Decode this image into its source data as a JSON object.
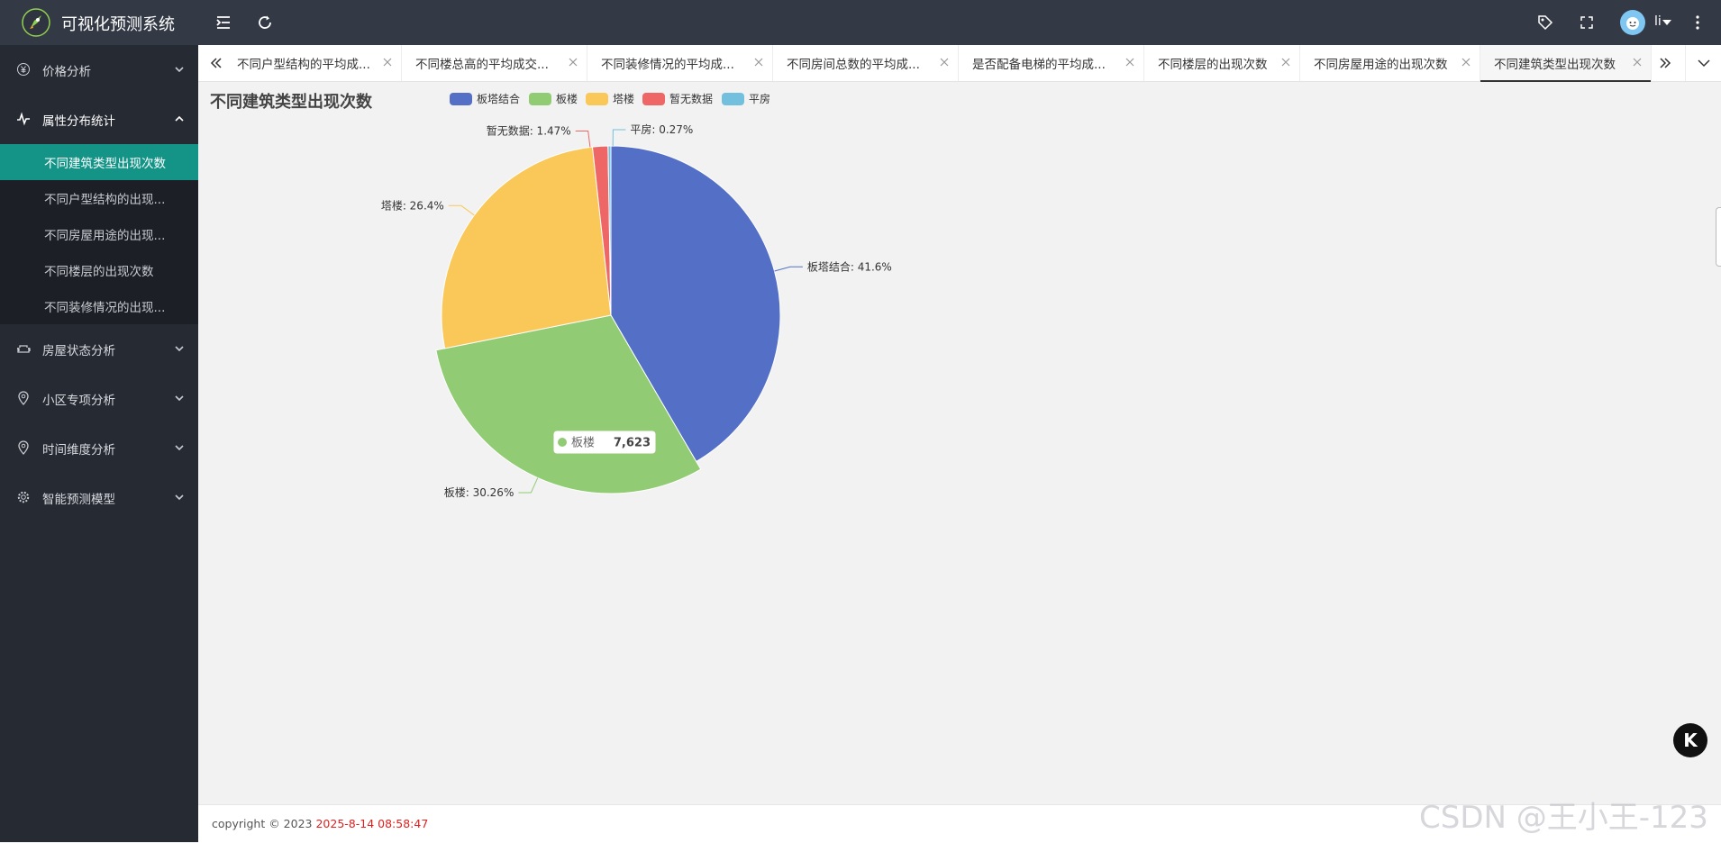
{
  "header": {
    "app_title": "可视化预测系统",
    "user_name": "li",
    "icons": [
      "logo-rocket-icon",
      "menu-fold-icon",
      "refresh-icon",
      "tag-icon",
      "fullscreen-icon",
      "avatar",
      "caret-down-icon",
      "more-vertical-icon"
    ]
  },
  "sidebar": {
    "groups": [
      {
        "label": "价格分析",
        "icon": "yen-icon",
        "expanded": false
      },
      {
        "label": "属性分布统计",
        "icon": "pulse-icon",
        "expanded": true
      },
      {
        "label": "房屋状态分析",
        "icon": "sofa-icon",
        "expanded": false
      },
      {
        "label": "小区专项分析",
        "icon": "location-pin-icon",
        "expanded": false
      },
      {
        "label": "时间维度分析",
        "icon": "location-pin-icon",
        "expanded": false
      },
      {
        "label": "智能预测模型",
        "icon": "gear-icon",
        "expanded": false
      }
    ],
    "sub_items": [
      {
        "label": "不同建筑类型出现次数",
        "active": true
      },
      {
        "label": "不同户型结构的出现...",
        "active": false
      },
      {
        "label": "不同房屋用途的出现...",
        "active": false
      },
      {
        "label": "不同楼层的出现次数",
        "active": false
      },
      {
        "label": "不同装修情况的出现...",
        "active": false
      }
    ]
  },
  "tabs": [
    {
      "label": "不同户型结构的平均成..."
    },
    {
      "label": "不同楼总高的平均成交..."
    },
    {
      "label": "不同装修情况的平均成..."
    },
    {
      "label": "不同房间总数的平均成..."
    },
    {
      "label": "是否配备电梯的平均成..."
    },
    {
      "label": "不同楼层的出现次数"
    },
    {
      "label": "不同房屋用途的出现次数"
    },
    {
      "label": "不同建筑类型出现次数",
      "active": true
    }
  ],
  "chart_data": {
    "type": "pie",
    "title": "不同建筑类型出现次数",
    "legend_position": "top",
    "categories": [
      "板塔结合",
      "板楼",
      "塔楼",
      "暂无数据",
      "平房"
    ],
    "percentages": [
      41.6,
      30.26,
      26.4,
      1.47,
      0.27
    ],
    "slice_labels": [
      "板塔结合: 41.6%",
      "板楼: 30.26%",
      "塔楼: 26.4%",
      "暂无数据: 1.47%",
      "平房: 0.27%"
    ],
    "colors": [
      "#5470c6",
      "#91cc75",
      "#fac858",
      "#ee6666",
      "#73c0de"
    ],
    "highlighted": {
      "category": "板楼",
      "value": 7623,
      "value_text": "7,623"
    }
  },
  "footer": {
    "copyright": "copyright © 2023 ",
    "timestamp": "2025-8-14 08:58:47"
  },
  "watermark": "CSDN @王小王-123",
  "floating_button": "K"
}
